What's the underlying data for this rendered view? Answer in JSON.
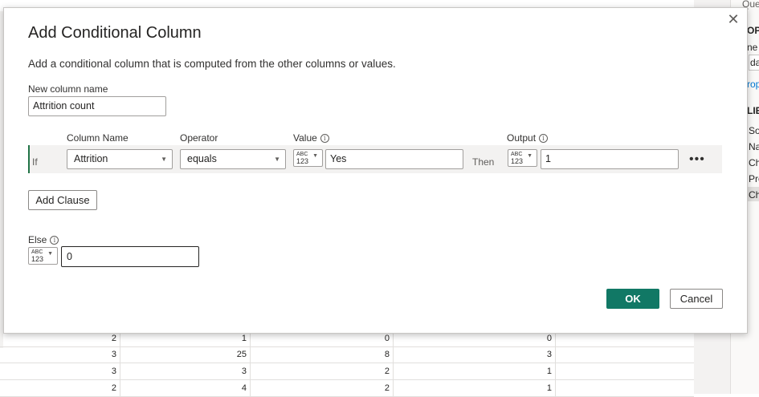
{
  "background": {
    "grid_rows": [
      [
        "2",
        "1",
        "0",
        "0"
      ],
      [
        "3",
        "25",
        "8",
        "3"
      ],
      [
        "3",
        "3",
        "2",
        "1"
      ],
      [
        "2",
        "4",
        "2",
        "1"
      ]
    ],
    "right_pane": {
      "top_label": "Query S",
      "section1": "OPE",
      "field_label": "ne",
      "field_value": "da",
      "link": "rop",
      "section2": "LIE",
      "steps": [
        "So",
        "Na",
        "Ch",
        "Pro",
        "Ch"
      ]
    }
  },
  "dialog": {
    "title": "Add Conditional Column",
    "close_glyph": "✕",
    "description": "Add a conditional column that is computed from the other columns or values.",
    "new_column_name_label": "New column name",
    "new_column_name_value": "Attrition count",
    "headers": {
      "column_name": "Column Name",
      "operator": "Operator",
      "value": "Value",
      "output": "Output"
    },
    "clause": {
      "if_label": "If",
      "column": "Attrition",
      "operator": "equals",
      "value_type_top": "ABC",
      "value_type_bottom": "123",
      "value": "Yes",
      "then_label": "Then",
      "output_type_top": "ABC",
      "output_type_bottom": "123",
      "output": "1",
      "more_glyph": "•••"
    },
    "add_clause_label": "Add Clause",
    "else_label": "Else",
    "else_type_top": "ABC",
    "else_type_bottom": "123",
    "else_value": "0",
    "ok_label": "OK",
    "cancel_label": "Cancel"
  },
  "colors": {
    "primary": "#117865",
    "row_accent": "#217346"
  }
}
